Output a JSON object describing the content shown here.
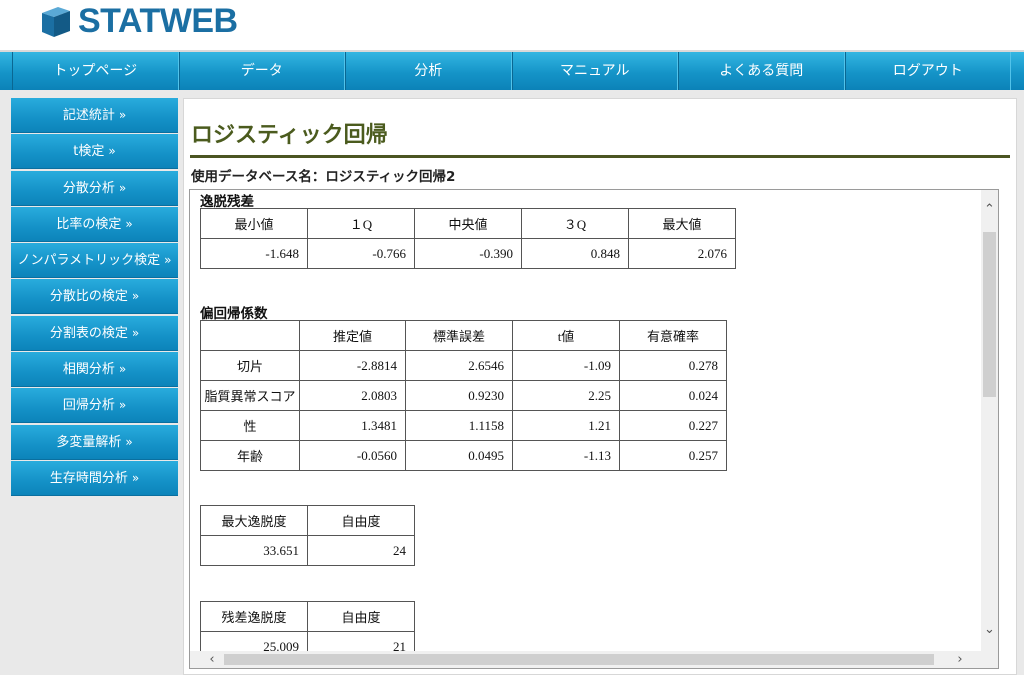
{
  "app": {
    "logo_text": "STATWEB"
  },
  "nav": {
    "items": [
      "トップページ",
      "データ",
      "分析",
      "マニュアル",
      "よくある質問",
      "ログアウト"
    ]
  },
  "sidebar": {
    "chevron": "»",
    "items": [
      "記述統計",
      "t検定",
      "分散分析",
      "比率の検定",
      "ノンパラメトリック検定",
      "分散比の検定",
      "分割表の検定",
      "相関分析",
      "回帰分析",
      "多変量解析",
      "生存時間分析"
    ]
  },
  "main": {
    "title": "ロジスティック回帰",
    "db_label": "使用データベース名：ロジスティック回帰2"
  },
  "residuals": {
    "title": "逸脱残差",
    "headers": [
      "最小値",
      "１Q",
      "中央値",
      "３Q",
      "最大値"
    ],
    "values": [
      "-1.648",
      "-0.766",
      "-0.390",
      "0.848",
      "2.076"
    ]
  },
  "coefficients": {
    "title": "偏回帰係数",
    "headers": [
      "",
      "推定値",
      "標準誤差",
      "t値",
      "有意確率"
    ],
    "rows": [
      [
        "切片",
        "-2.8814",
        "2.6546",
        "-1.09",
        "0.278"
      ],
      [
        "脂質異常スコア",
        "2.0803",
        "0.9230",
        "2.25",
        "0.024"
      ],
      [
        "性",
        "1.3481",
        "1.1158",
        "1.21",
        "0.227"
      ],
      [
        "年齢",
        "-0.0560",
        "0.0495",
        "-1.13",
        "0.257"
      ]
    ]
  },
  "max_deviance": {
    "headers": [
      "最大逸脱度",
      "自由度"
    ],
    "values": [
      "33.651",
      "24"
    ]
  },
  "residual_deviance": {
    "headers": [
      "残差逸脱度",
      "自由度"
    ],
    "values": [
      "25.009",
      "21"
    ]
  },
  "icons": {
    "scroll_up": "up-arrow",
    "scroll_down": "down-arrow",
    "scroll_left": "left-arrow",
    "scroll_right": "right-arrow"
  },
  "colors": {
    "nav_blue": "#1594c8",
    "title_olive": "#4b5b1e",
    "logo_blue": "#1b6fa3"
  }
}
